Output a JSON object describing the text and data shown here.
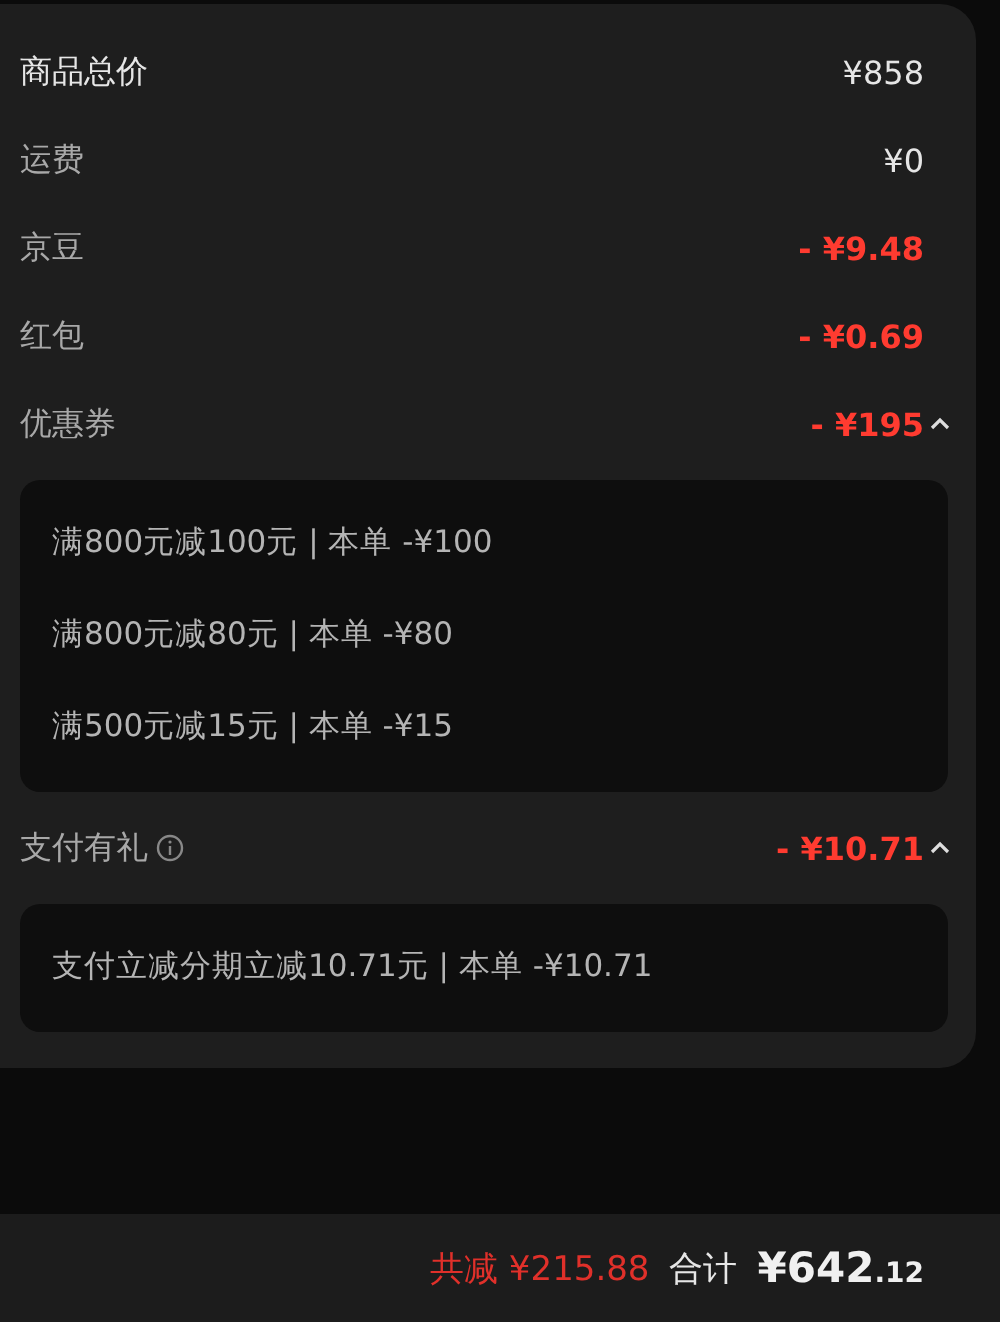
{
  "rows": [
    {
      "label": "商品总价",
      "value": "¥858",
      "kind": "price",
      "emphasis": true
    },
    {
      "label": "运费",
      "value": "¥0",
      "kind": "price",
      "emphasis": false
    },
    {
      "label": "京豆",
      "value": "- ¥9.48",
      "kind": "discount",
      "emphasis": false
    },
    {
      "label": "红包",
      "value": "- ¥0.69",
      "kind": "discount",
      "emphasis": false
    },
    {
      "label": "优惠券",
      "value": "- ¥195",
      "kind": "discount",
      "emphasis": false,
      "expanded": true,
      "details": [
        "满800元减100元 | 本单 -¥100",
        "满800元减80元 | 本单 -¥80",
        "满500元减15元 | 本单 -¥15"
      ]
    },
    {
      "label": "支付有礼",
      "value": "- ¥10.71",
      "kind": "discount",
      "emphasis": false,
      "info": true,
      "expanded": true,
      "details": [
        "支付立减分期立减10.71元 | 本单 -¥10.71"
      ]
    }
  ],
  "footer": {
    "savings": "共减 ¥215.88",
    "total_label": "合计",
    "total_integer": "¥642",
    "total_decimal": ".12"
  }
}
